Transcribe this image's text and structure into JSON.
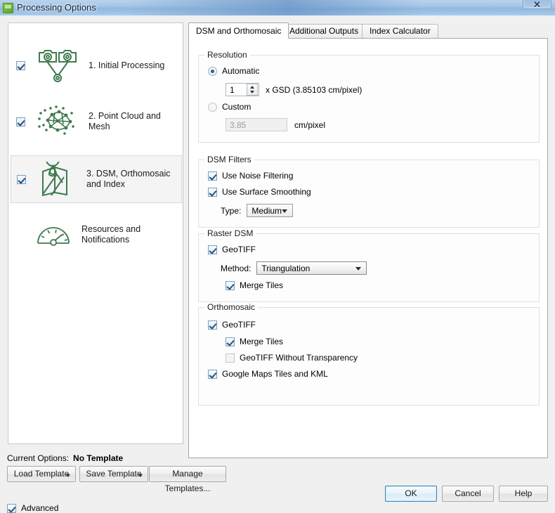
{
  "window": {
    "title": "Processing Options",
    "close_label": "✕",
    "app_icon": "pix4d-green-icon"
  },
  "sidebar": {
    "items": [
      {
        "label": "1. Initial Processing",
        "checked": true,
        "selected": false,
        "icon": "two-cameras-icon"
      },
      {
        "label": "2. Point Cloud and Mesh",
        "checked": true,
        "selected": false,
        "icon": "point-cloud-mesh-icon"
      },
      {
        "label": "3. DSM, Orthomosaic and Index",
        "checked": true,
        "selected": true,
        "icon": "map-pin-icon"
      },
      {
        "label": "Resources and Notifications",
        "checked": null,
        "selected": false,
        "icon": "gauge-icon"
      }
    ]
  },
  "tabs": [
    {
      "label": "DSM and Orthomosaic",
      "active": true
    },
    {
      "label": "Additional Outputs",
      "active": false
    },
    {
      "label": "Index Calculator",
      "active": false
    }
  ],
  "resolution": {
    "group_title": "Resolution",
    "automatic_label": "Automatic",
    "automatic_selected": true,
    "gsd_multiplier": "1",
    "gsd_suffix": "x GSD (3.85103 cm/pixel)",
    "custom_label": "Custom",
    "custom_selected": false,
    "custom_value": "3.85",
    "custom_unit": "cm/pixel"
  },
  "dsm_filters": {
    "group_title": "DSM Filters",
    "noise_filtering_label": "Use Noise Filtering",
    "noise_filtering_checked": true,
    "surface_smoothing_label": "Use Surface Smoothing",
    "surface_smoothing_checked": true,
    "type_label": "Type:",
    "type_value": "Medium"
  },
  "raster_dsm": {
    "group_title": "Raster DSM",
    "geotiff_label": "GeoTIFF",
    "geotiff_checked": true,
    "method_label": "Method:",
    "method_value": "Triangulation",
    "merge_tiles_label": "Merge Tiles",
    "merge_tiles_checked": true
  },
  "orthomosaic": {
    "group_title": "Orthomosaic",
    "geotiff_label": "GeoTIFF",
    "geotiff_checked": true,
    "merge_tiles_label": "Merge Tiles",
    "merge_tiles_checked": true,
    "no_transparency_label": "GeoTIFF Without Transparency",
    "no_transparency_checked": false,
    "google_maps_label": "Google Maps Tiles and KML",
    "google_maps_checked": true
  },
  "footer": {
    "current_options_label": "Current Options:",
    "current_options_value": "No Template",
    "load_template": "Load Template",
    "save_template": "Save Template",
    "manage_templates": "Manage Templates...",
    "advanced_label": "Advanced",
    "advanced_checked": true,
    "ok": "OK",
    "cancel": "Cancel",
    "help": "Help"
  },
  "colors": {
    "accent_green": "#3f7a4e",
    "title_blue": "#8fb9e0",
    "default_button_border": "#3c8ab8"
  }
}
